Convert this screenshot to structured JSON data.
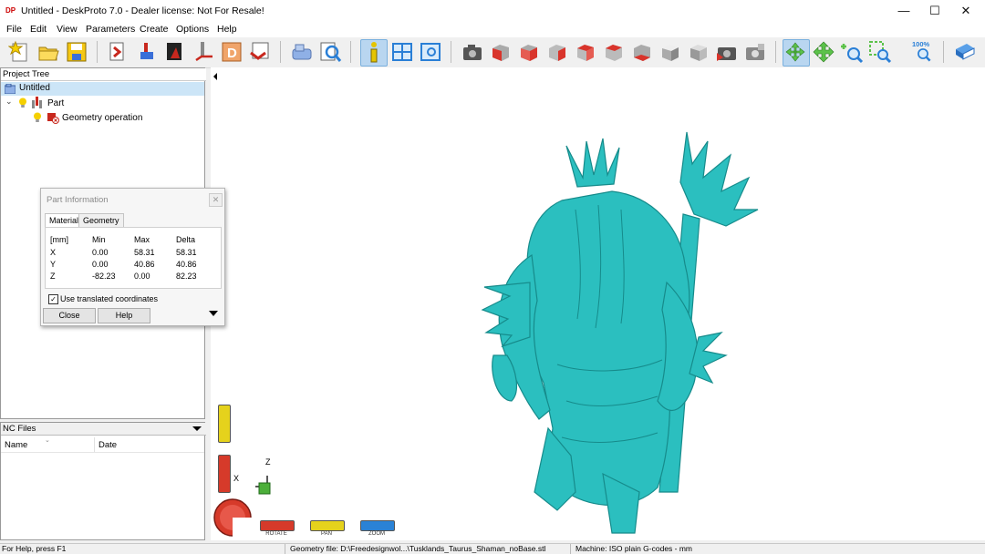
{
  "window": {
    "app_icon_text": "DP",
    "title": "Untitled - DeskProto 7.0 - Dealer license: Not For Resale!",
    "controls": [
      "—",
      "☐",
      "✕"
    ]
  },
  "menu": [
    "File",
    "Edit",
    "View",
    "Parameters",
    "Create",
    "Options",
    "Help"
  ],
  "toolbar": {
    "zoom_percent_label": "100%",
    "icons": [
      "new-project-icon",
      "open-project-icon",
      "save-project-icon",
      "import-geometry-icon",
      "part-parameters-icon",
      "operation-parameters-icon",
      "toolpath-icon",
      "drawing-icon",
      "save-nc-icon",
      "machine-icon",
      "simulation-icon",
      "info-icon",
      "split-view-icon",
      "preview-icon",
      "camera-view-icon",
      "view-front-icon",
      "view-back-icon",
      "view-left-icon",
      "view-right-icon",
      "view-top-icon",
      "view-bottom-icon",
      "view-iso-icon",
      "view-iso2-icon",
      "render-icon",
      "render2-icon",
      "rotate-view-icon",
      "pan-view-icon",
      "zoom-in-icon",
      "zoom-window-icon",
      "zoom-100-icon",
      "help-book-icon"
    ]
  },
  "project_tree": {
    "header": "Project Tree",
    "items": [
      {
        "label": "Untitled",
        "level": 0
      },
      {
        "label": "Part",
        "level": 1
      },
      {
        "label": "Geometry operation",
        "level": 2
      }
    ]
  },
  "nc_files": {
    "header": "NC Files",
    "columns": [
      "Name",
      "Date"
    ]
  },
  "part_info_dialog": {
    "title": "Part Information",
    "tabs": [
      "Material",
      "Geometry"
    ],
    "active_tab": "Material",
    "table": {
      "headers": [
        "[mm]",
        "Min",
        "Max",
        "Delta"
      ],
      "rows": [
        [
          "X",
          "0.00",
          "58.31",
          "58.31"
        ],
        [
          "Y",
          "0.00",
          "40.86",
          "40.86"
        ],
        [
          "Z",
          "-82.23",
          "0.00",
          "82.23"
        ]
      ]
    },
    "checkbox_label": "Use translated coordinates",
    "checkbox_checked": true,
    "buttons": [
      "Close",
      "Help"
    ]
  },
  "viewport": {
    "axis_labels": {
      "z": "Z",
      "x": "X"
    },
    "model_color": "#2bbfbf",
    "mode_buttons": [
      "ROTATE",
      "PAN",
      "ZOOM"
    ],
    "mode_colors": [
      "#d63a2a",
      "#e5d21c",
      "#2a82d6"
    ]
  },
  "status_bar": {
    "help": "For Help, press F1",
    "geometry_file": "Geometry file: D:\\Freedesignwol...\\Tusklands_Taurus_Shaman_noBase.stl",
    "machine": "Machine: ISO plain G-codes - mm"
  }
}
